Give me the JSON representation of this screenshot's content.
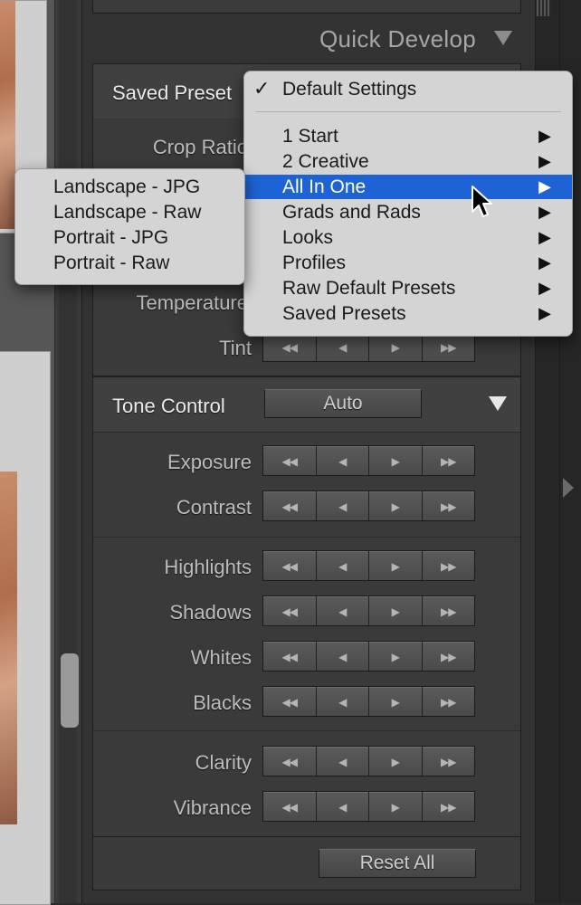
{
  "panel": {
    "title": "Quick Develop",
    "saved_preset": {
      "label": "Saved Preset",
      "menu": {
        "checked_item": "Default Settings",
        "items": [
          "1 Start",
          "2 Creative",
          "All In One",
          "Grads and Rads",
          "Looks",
          "Profiles",
          "Raw Default Presets",
          "Saved Presets"
        ],
        "highlighted": "All In One",
        "submenu_arrow": "▶"
      },
      "submenu": {
        "items": [
          "Landscape - JPG",
          "Landscape - Raw",
          "Portrait - JPG",
          "Portrait - Raw"
        ]
      }
    },
    "crop_ratio_label": "Crop Ratio",
    "temperature_label": "Temperature",
    "tint_label": "Tint",
    "tone_control": {
      "label": "Tone Control",
      "auto_label": "Auto",
      "rows": [
        "Exposure",
        "Contrast",
        "Highlights",
        "Shadows",
        "Whites",
        "Blacks",
        "Clarity",
        "Vibrance"
      ]
    },
    "step_buttons": {
      "big_decrease": "◀◀",
      "decrease": "◀",
      "increase": "▶",
      "big_increase": "▶▶"
    },
    "reset_all_label": "Reset All"
  },
  "colors": {
    "menu_highlight": "#1d63d6",
    "panel_bg": "#3a3a3a",
    "menu_bg": "#d4d4d4"
  },
  "icons": {
    "collapse": "triangle-down-icon",
    "submenu": "chevron-right-icon",
    "cursor": "mouse-pointer-icon"
  }
}
